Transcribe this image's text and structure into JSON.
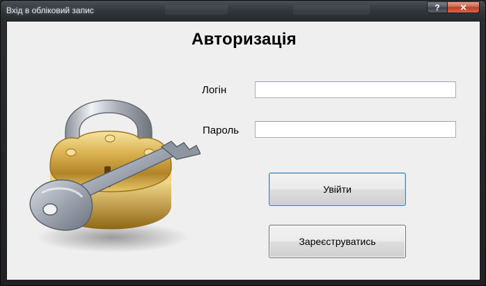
{
  "window": {
    "title": "Вхід в обліковий запис",
    "help_label": "?",
    "close_label": "✕"
  },
  "form": {
    "heading": "Авторизація",
    "login_label": "Логін",
    "login_value": "",
    "password_label": "Пароль",
    "password_value": "",
    "submit_label": "Увійти",
    "register_label": "Зареєструватись"
  },
  "icons": {
    "illustration": "padlock-with-key-icon"
  },
  "colors": {
    "client_bg": "#efefef",
    "focus_border": "#3c7fb1",
    "close_red": "#c03c24"
  }
}
